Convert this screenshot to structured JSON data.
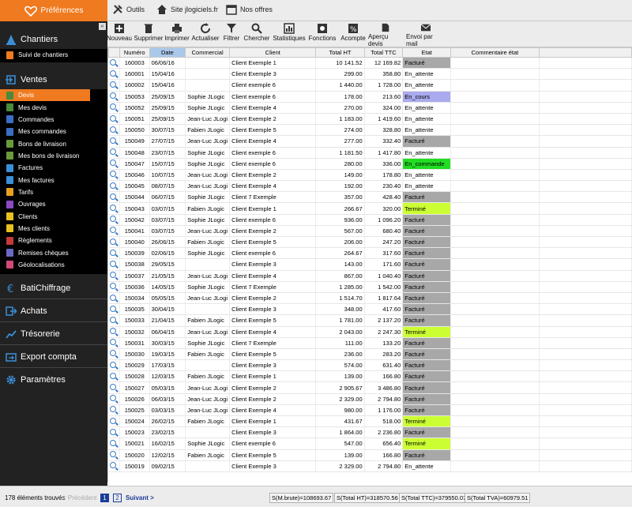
{
  "topbar": {
    "preferences": "Préférences",
    "outils": "Outils",
    "site": "Site jlogiciels.fr",
    "offres": "Nos offres"
  },
  "sidebar": {
    "collapse": "«",
    "chantiers": {
      "title": "Chantiers",
      "items": [
        "Suivi de chantiers"
      ]
    },
    "ventes": {
      "title": "Ventes",
      "items": [
        "Devis",
        "Mes devis",
        "Commandes",
        "Mes commandes",
        "Bons de livraison",
        "Mes bons de livraison",
        "Factures",
        "Mes factures",
        "Tarifs",
        "Ouvrages",
        "Clients",
        "Mes clients",
        "Règlements",
        "Remises chèques",
        "Géolocalisations"
      ]
    },
    "sections": [
      "BatiChiffrage",
      "Achats",
      "Trésorerie",
      "Export compta",
      "Paramètres"
    ]
  },
  "toolbar": {
    "buttons": [
      "Nouveau",
      "Supprimer",
      "Imprimer",
      "Actualiser",
      "Filtrer",
      "Chercher",
      "Statistiques",
      "Fonctions",
      "Acompte",
      "Aperçu devis",
      "Envoi par mail"
    ]
  },
  "table": {
    "headers": [
      "Numéro",
      "Date",
      "Commercial",
      "Client",
      "Total HT",
      "Total TTC",
      "Etat",
      "Commentaire état"
    ],
    "rows": [
      [
        "160003",
        "06/06/16",
        "",
        "Client Exemple 1",
        "10 141.52",
        "12 169.82",
        "Facturé"
      ],
      [
        "160001",
        "15/04/16",
        "",
        "Client Exemple 3",
        "299.00",
        "358.80",
        "En_attente"
      ],
      [
        "160002",
        "15/04/16",
        "",
        "Client exemple 6",
        "1 440.00",
        "1 728.00",
        "En_attente"
      ],
      [
        "150053",
        "25/09/15",
        "Sophie JLogic",
        "Client exemple 6",
        "178.00",
        "213.60",
        "En_cours"
      ],
      [
        "150052",
        "25/09/15",
        "Sophie JLogic",
        "Client Exemple 4",
        "270.00",
        "324.00",
        "En_attente"
      ],
      [
        "150051",
        "25/09/15",
        "Jean-Luc JLogi",
        "Client Exemple 2",
        "1 183.00",
        "1 419.60",
        "En_attente"
      ],
      [
        "150050",
        "30/07/15",
        "Fabien JLogic",
        "Client Exemple 5",
        "274.00",
        "328.80",
        "En_attente"
      ],
      [
        "150049",
        "27/07/15",
        "Jean-Luc JLogi",
        "Client Exemple 4",
        "277.00",
        "332.40",
        "Facturé"
      ],
      [
        "150048",
        "23/07/15",
        "Sophie JLogic",
        "Client exemple 6",
        "1 181.50",
        "1 417.80",
        "En_attente"
      ],
      [
        "150047",
        "15/07/15",
        "Sophie JLogic",
        "Client exemple 6",
        "280.00",
        "336.00",
        "En_commande"
      ],
      [
        "150046",
        "10/07/15",
        "Jean-Luc JLogi",
        "Client Exemple 2",
        "149.00",
        "178.80",
        "En_attente"
      ],
      [
        "150045",
        "08/07/15",
        "Jean-Luc JLogi",
        "Client Exemple 4",
        "192.00",
        "230.40",
        "En_attente"
      ],
      [
        "150044",
        "06/07/15",
        "Sophie JLogic",
        "Client 7 Exemple",
        "357.00",
        "428.40",
        "Facturé"
      ],
      [
        "150043",
        "03/07/15",
        "Fabien JLogic",
        "Client Exemple 1",
        "266.67",
        "320.00",
        "Terminé"
      ],
      [
        "150042",
        "03/07/15",
        "Sophie JLogic",
        "Client exemple 6",
        "936.00",
        "1 096.20",
        "Facturé"
      ],
      [
        "150041",
        "03/07/15",
        "Jean-Luc JLogi",
        "Client Exemple 2",
        "567.00",
        "680.40",
        "Facturé"
      ],
      [
        "150040",
        "26/06/15",
        "Fabien JLogic",
        "Client Exemple 5",
        "206.00",
        "247.20",
        "Facturé"
      ],
      [
        "150039",
        "02/06/15",
        "Sophie JLogic",
        "Client exemple 6",
        "264.67",
        "317.60",
        "Facturé"
      ],
      [
        "150038",
        "29/05/15",
        "",
        "Client Exemple 3",
        "143.00",
        "171.60",
        "Facturé"
      ],
      [
        "150037",
        "21/05/15",
        "Jean-Luc JLogi",
        "Client Exemple 4",
        "867.00",
        "1 040.40",
        "Facturé"
      ],
      [
        "150036",
        "14/05/15",
        "Sophie JLogic",
        "Client 7 Exemple",
        "1 285.00",
        "1 542.00",
        "Facturé"
      ],
      [
        "150034",
        "05/05/15",
        "Jean-Luc JLogi",
        "Client Exemple 2",
        "1 514.70",
        "1 817.64",
        "Facturé"
      ],
      [
        "150035",
        "30/04/15",
        "",
        "Client Exemple 3",
        "348.00",
        "417.60",
        "Facturé"
      ],
      [
        "150033",
        "21/04/15",
        "Fabien JLogic",
        "Client Exemple 5",
        "1 781.00",
        "2 137.20",
        "Facturé"
      ],
      [
        "150032",
        "06/04/15",
        "Jean-Luc JLogi",
        "Client Exemple 4",
        "2 043.00",
        "2 247.30",
        "Terminé"
      ],
      [
        "150031",
        "30/03/15",
        "Sophie JLogic",
        "Client 7 Exemple",
        "111.00",
        "133.20",
        "Facturé"
      ],
      [
        "150030",
        "19/03/15",
        "Fabien JLogic",
        "Client Exemple 5",
        "236.00",
        "283.20",
        "Facturé"
      ],
      [
        "150029",
        "17/03/15",
        "",
        "Client Exemple 3",
        "574.00",
        "631.40",
        "Facturé"
      ],
      [
        "150028",
        "12/03/15",
        "Fabien JLogic",
        "Client Exemple 1",
        "139.00",
        "166.80",
        "Facturé"
      ],
      [
        "150027",
        "05/03/15",
        "Jean-Luc JLogi",
        "Client Exemple 2",
        "2 905.67",
        "3 486.80",
        "Facturé"
      ],
      [
        "150026",
        "06/03/15",
        "Jean-Luc JLogi",
        "Client Exemple 2",
        "2 329.00",
        "2 794.80",
        "Facturé"
      ],
      [
        "150025",
        "03/03/15",
        "Jean-Luc JLogi",
        "Client Exemple 4",
        "980.00",
        "1 176.00",
        "Facturé"
      ],
      [
        "150024",
        "26/02/15",
        "Fabien JLogic",
        "Client Exemple 1",
        "431.67",
        "518.00",
        "Terminé"
      ],
      [
        "150023",
        "23/02/15",
        "",
        "Client Exemple 3",
        "1 864.00",
        "2 236.80",
        "Facturé"
      ],
      [
        "150021",
        "16/02/15",
        "Sophie JLogic",
        "Client exemple 6",
        "547.00",
        "656.40",
        "Terminé"
      ],
      [
        "150020",
        "12/02/15",
        "Fabien JLogic",
        "Client Exemple 5",
        "139.00",
        "166.80",
        "Facturé"
      ],
      [
        "150019",
        "09/02/15",
        "",
        "Client Exemple 3",
        "2 329.00",
        "2 794.80",
        "En_attente"
      ]
    ]
  },
  "status": {
    "count": "178 éléments trouvés",
    "prev": "< Précédent",
    "page1": "1",
    "page2": "2",
    "next": "Suivant >",
    "sums": [
      "S(M.brute)=108693.67",
      "S(Total HT)=318570.56",
      "S(Total TTC)=379550.07",
      "S(Total TVA)=60979.51"
    ]
  },
  "colors": {
    "accent": "#f07a1f",
    "sidebar": "#222222",
    "facture": "#a8a8a8",
    "termine": "#ccff33",
    "en_cours": "#aaaaee",
    "en_commande": "#22dd22"
  }
}
